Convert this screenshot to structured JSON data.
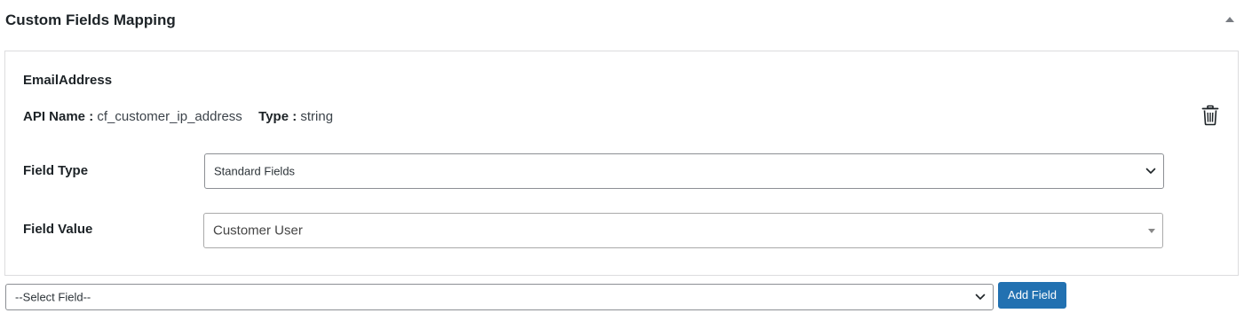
{
  "section": {
    "title": "Custom Fields Mapping",
    "collapse_icon": "triangle-up-icon"
  },
  "mapping": {
    "field_name": "EmailAddress",
    "api_name_label": "API Name :",
    "api_name_value": "cf_customer_ip_address",
    "type_label": "Type :",
    "type_value": "string",
    "delete_icon": "trash-icon",
    "field_type_label": "Field Type",
    "field_type_selected": "Standard Fields",
    "field_value_label": "Field Value",
    "field_value_selected": "Customer User"
  },
  "footer": {
    "select_field_selected": "--Select Field--",
    "add_field_label": "Add Field"
  },
  "colors": {
    "accent": "#2271b1",
    "border": "#dcdcde",
    "text": "#1d2327"
  }
}
